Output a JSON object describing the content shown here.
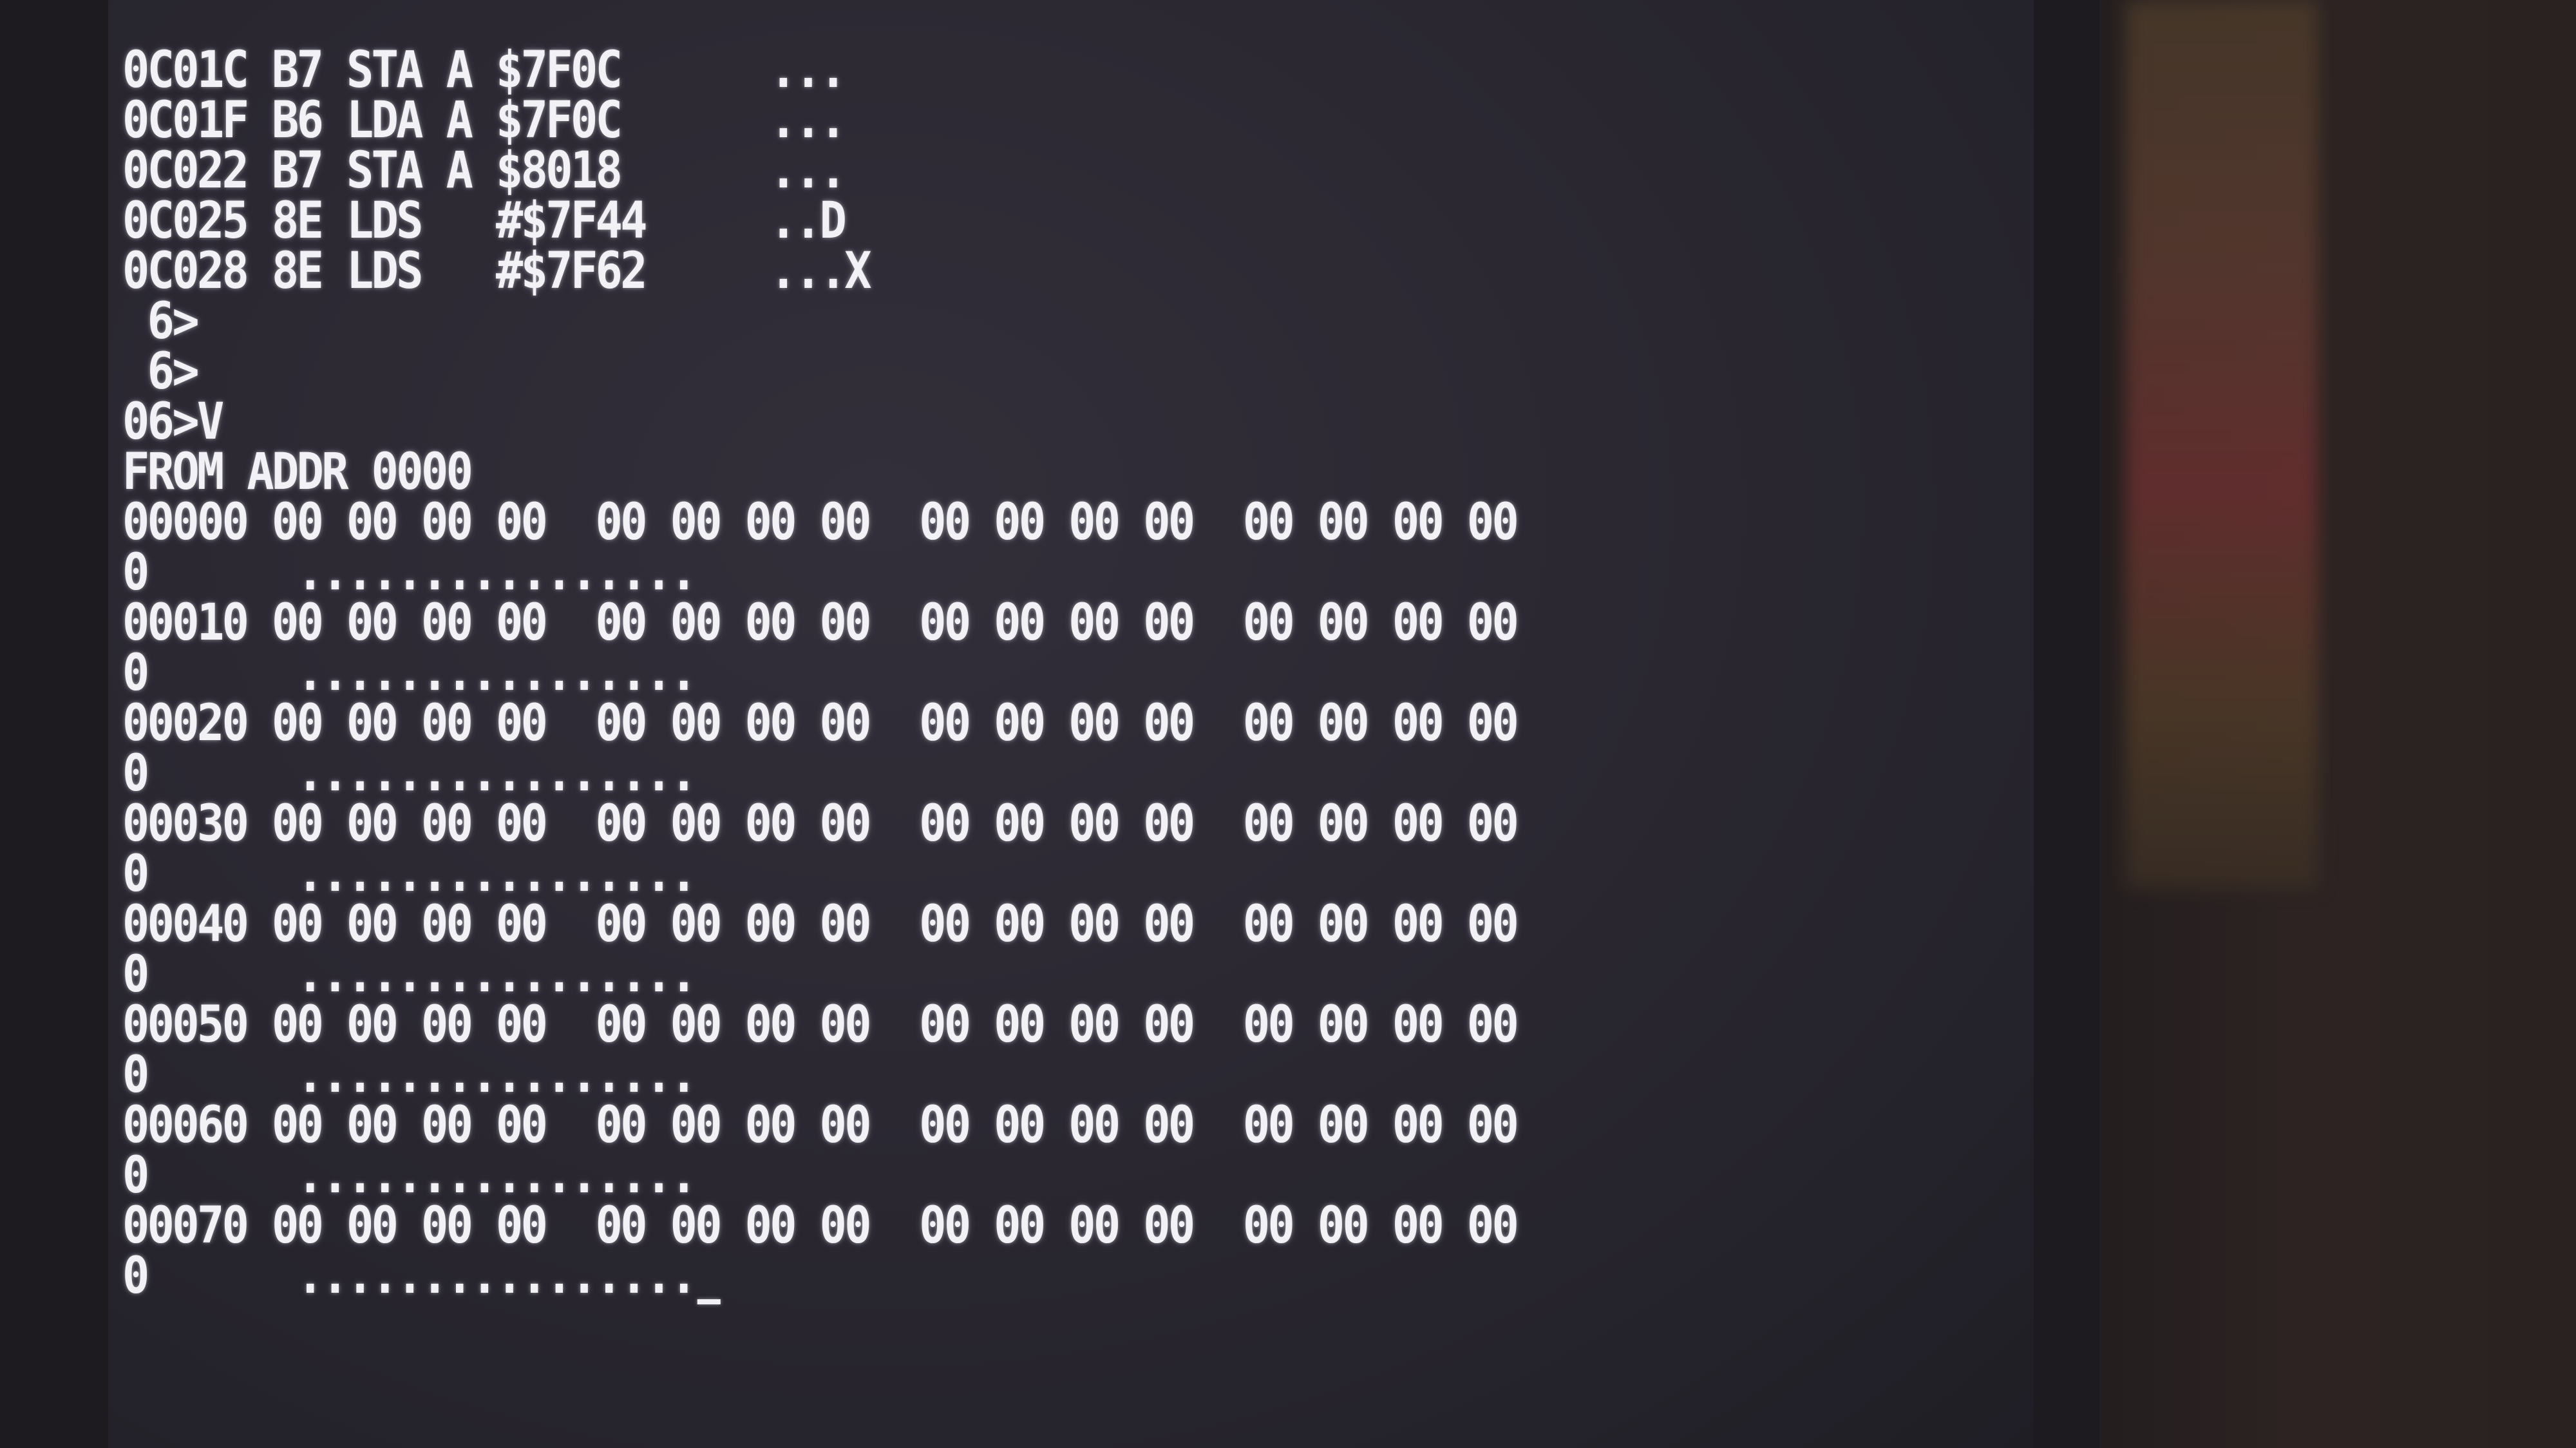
{
  "terminal": {
    "disassembly": [
      "0C01C B7 STA A $7F0C      ...",
      "0C01F B6 LDA A $7F0C      ...",
      "0C022 B7 STA A $8018      ...",
      "0C025 8E LDS   #$7F44     ..D",
      "0C028 8E LDS   #$7F62     ...X"
    ],
    "prompts": [
      " 6>",
      " 6>",
      "06>V"
    ],
    "from_addr": "FROM ADDR 0000",
    "dump": [
      {
        "addr": "00000 00 00 00 00  00 00 00 00  00 00 00 00  00 00 00 00",
        "ascii": "0      ................"
      },
      {
        "addr": "00010 00 00 00 00  00 00 00 00  00 00 00 00  00 00 00 00",
        "ascii": "0      ................"
      },
      {
        "addr": "00020 00 00 00 00  00 00 00 00  00 00 00 00  00 00 00 00",
        "ascii": "0      ................"
      },
      {
        "addr": "00030 00 00 00 00  00 00 00 00  00 00 00 00  00 00 00 00",
        "ascii": "0      ................"
      },
      {
        "addr": "00040 00 00 00 00  00 00 00 00  00 00 00 00  00 00 00 00",
        "ascii": "0      ................"
      },
      {
        "addr": "00050 00 00 00 00  00 00 00 00  00 00 00 00  00 00 00 00",
        "ascii": "0      ................"
      },
      {
        "addr": "00060 00 00 00 00  00 00 00 00  00 00 00 00  00 00 00 00",
        "ascii": "0      ................"
      },
      {
        "addr": "00070 00 00 00 00  00 00 00 00  00 00 00 00  00 00 00 00",
        "ascii": "0      ................"
      }
    ]
  }
}
